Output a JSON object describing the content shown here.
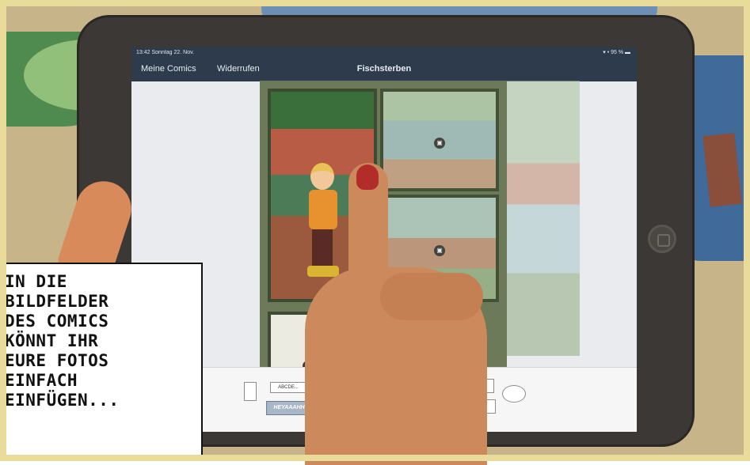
{
  "statusbar": {
    "time": "13:42  Sonntag 22. Nov.",
    "right": "▾ • 95 % ▬"
  },
  "navbar": {
    "back_label": "Meine Comics",
    "undo_label": "Widerrufen",
    "title": "Fischsterben"
  },
  "toolbar": {
    "text_tool_label": "ABCDE...",
    "sticker_label": "HEYAAAHH"
  },
  "caption": {
    "lines": [
      "IN DIE",
      "BILDFELDER",
      "DES COMICS",
      "KÖNNT IHR",
      "EURE FOTOS",
      "EINFACH",
      "EINFÜGEN..."
    ]
  },
  "icons": {
    "image_placeholder": "image-icon",
    "home": "home-button-icon"
  },
  "colors": {
    "navbar": "#2e3b4c",
    "background": "#c8b489",
    "frame": "#e9dc9a",
    "caption_bg": "#ffffff"
  }
}
